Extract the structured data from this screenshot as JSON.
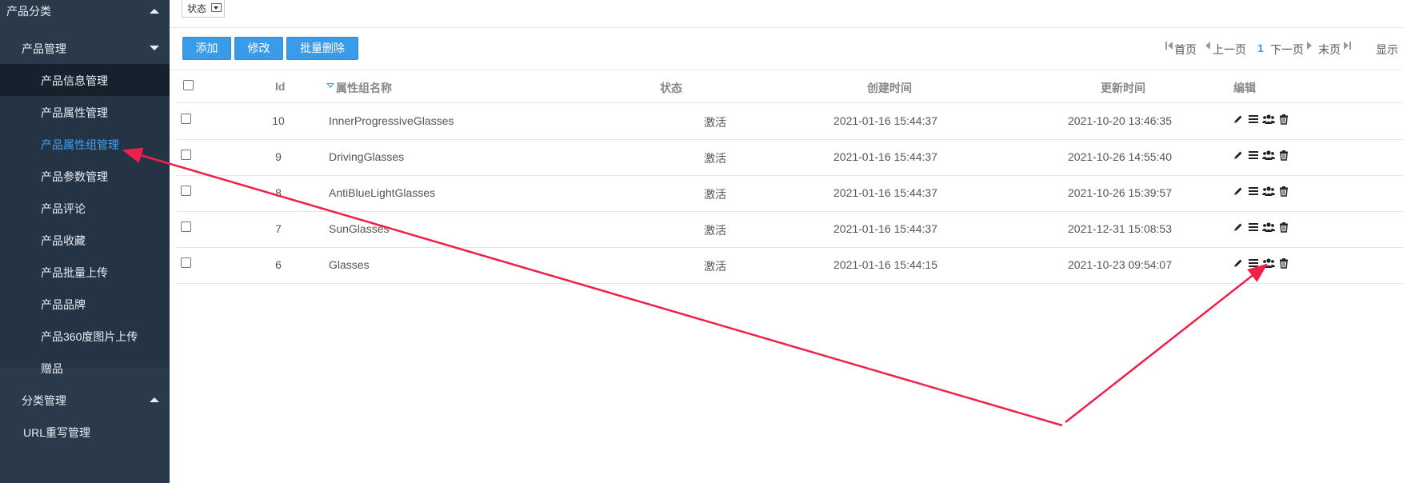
{
  "sidebar": {
    "top_label": "产品分类",
    "group1": "产品管理",
    "items": [
      {
        "label": "产品信息管理"
      },
      {
        "label": "产品属性管理"
      },
      {
        "label": "产品属性组管理"
      },
      {
        "label": "产品参数管理"
      },
      {
        "label": "产品评论"
      },
      {
        "label": "产品收藏"
      },
      {
        "label": "产品批量上传"
      },
      {
        "label": "产品品牌"
      },
      {
        "label": "产品360度图片上传"
      },
      {
        "label": "赠品"
      }
    ],
    "group2": "分类管理",
    "url_rewrite": "URL重写管理"
  },
  "filter": {
    "status_label": "状态"
  },
  "toolbar": {
    "add": "添加",
    "edit": "修改",
    "batch_delete": "批量删除"
  },
  "pager": {
    "first": "首页",
    "prev": "上一页",
    "current": "1",
    "next": "下一页",
    "last": "末页",
    "show": "显示"
  },
  "table": {
    "headers": {
      "id": "Id",
      "name": "属性组名称",
      "status": "状态",
      "created": "创建时间",
      "updated": "更新时间",
      "edit": "编辑"
    },
    "rows": [
      {
        "id": "10",
        "name": "InnerProgressiveGlasses",
        "status": "激活",
        "created": "2021-01-16 15:44:37",
        "updated": "2021-10-20 13:46:35"
      },
      {
        "id": "9",
        "name": "DrivingGlasses",
        "status": "激活",
        "created": "2021-01-16 15:44:37",
        "updated": "2021-10-26 14:55:40"
      },
      {
        "id": "8",
        "name": "AntiBlueLightGlasses",
        "status": "激活",
        "created": "2021-01-16 15:44:37",
        "updated": "2021-10-26 15:39:57"
      },
      {
        "id": "7",
        "name": "SunGlasses",
        "status": "激活",
        "created": "2021-01-16 15:44:37",
        "updated": "2021-12-31 15:08:53"
      },
      {
        "id": "6",
        "name": "Glasses",
        "status": "激活",
        "created": "2021-01-16 15:44:15",
        "updated": "2021-10-23 09:54:07"
      }
    ],
    "row_icons": [
      "pencil-icon",
      "list-icon",
      "users-icon",
      "trash-icon"
    ]
  },
  "colors": {
    "sidebar_bg": "#2b3a4a",
    "active_link": "#3fa0f5",
    "button": "#3a9be9",
    "annotation_arrow": "#f0204a"
  }
}
